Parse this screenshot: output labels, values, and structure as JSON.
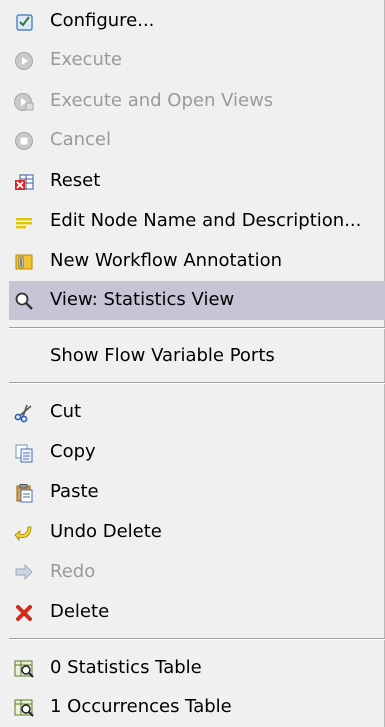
{
  "menu": {
    "configure": "Configure...",
    "execute": "Execute",
    "execute_open": "Execute and Open Views",
    "cancel": "Cancel",
    "reset": "Reset",
    "edit_node": "Edit Node Name and Description...",
    "new_annotation": "New Workflow Annotation",
    "view_stats": "View: Statistics View",
    "show_flow": "Show Flow Variable Ports",
    "cut": "Cut",
    "copy": "Copy",
    "paste": "Paste",
    "undo_delete": "Undo Delete",
    "redo": "Redo",
    "delete": "Delete",
    "stats_table": "0 Statistics Table",
    "occurrences_table": "1 Occurrences Table"
  },
  "colors": {
    "background": "#f0f0f0",
    "highlight": "#c8c4d6",
    "disabled_text": "#9a9a9a",
    "separator": "#a0a0a0"
  }
}
